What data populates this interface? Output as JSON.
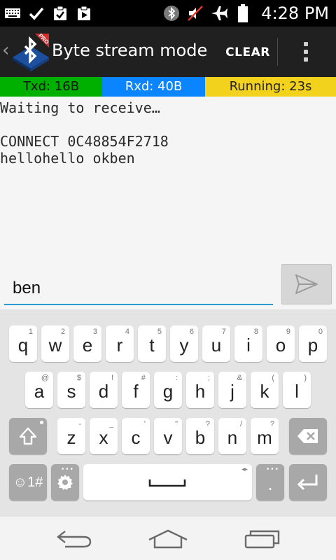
{
  "status_bar": {
    "time": "4:28 PM",
    "left_icons": [
      "keyboard-icon",
      "check-icon",
      "clipboard-check-icon",
      "clipboard-play-icon"
    ],
    "right_icons": [
      "bluetooth-icon",
      "muted-icon",
      "airplane-icon",
      "battery-icon"
    ]
  },
  "action_bar": {
    "title": "Byte stream mode",
    "logo_badge": "PRO",
    "clear_label": "CLEAR",
    "icons": [
      "back-caret-icon",
      "bluetooth-app-logo-icon",
      "overflow-menu-icon"
    ]
  },
  "counters": [
    {
      "label": "Txd: 16B",
      "color": "#00b000"
    },
    {
      "label": "Rxd: 40B",
      "color": "#0a84ff"
    },
    {
      "label": "Running: 23s",
      "color": "#f3d21d"
    }
  ],
  "terminal": {
    "lines": [
      "Waiting to receive…",
      "",
      "CONNECT 0C48854F2718",
      "hellohello okben"
    ]
  },
  "input": {
    "value": "ben",
    "accent": "#2a9ad0",
    "send_icon": "send-icon"
  },
  "keyboard": {
    "rows": [
      [
        {
          "label": "q",
          "hint": "1"
        },
        {
          "label": "w",
          "hint": "2"
        },
        {
          "label": "e",
          "hint": "3"
        },
        {
          "label": "r",
          "hint": "4"
        },
        {
          "label": "t",
          "hint": "5"
        },
        {
          "label": "y",
          "hint": "6"
        },
        {
          "label": "u",
          "hint": "7"
        },
        {
          "label": "i",
          "hint": "8"
        },
        {
          "label": "o",
          "hint": "9"
        },
        {
          "label": "p",
          "hint": "0"
        }
      ],
      [
        {
          "label": "a",
          "hint": "@"
        },
        {
          "label": "s",
          "hint": "$"
        },
        {
          "label": "d",
          "hint": "!"
        },
        {
          "label": "f",
          "hint": "#"
        },
        {
          "label": "g",
          "hint": ":"
        },
        {
          "label": "h",
          "hint": ";"
        },
        {
          "label": "j",
          "hint": "&"
        },
        {
          "label": "k",
          "hint": "("
        },
        {
          "label": "l",
          "hint": ")"
        }
      ],
      [
        {
          "label": "z",
          "hint": "-"
        },
        {
          "label": "x",
          "hint": "_"
        },
        {
          "label": "c",
          "hint": "'"
        },
        {
          "label": "v",
          "hint": "\""
        },
        {
          "label": "b",
          "hint": "?"
        },
        {
          "label": "n",
          "hint": "/"
        },
        {
          "label": "m",
          "hint": "?"
        }
      ]
    ],
    "mode_label": "☺1#",
    "period_label": ".",
    "icons": [
      "shift-icon",
      "backspace-icon",
      "settings-icon",
      "spacebar-icon",
      "enter-icon"
    ]
  },
  "nav_bar": {
    "icons": [
      "back-icon",
      "home-icon",
      "recent-apps-icon"
    ]
  }
}
